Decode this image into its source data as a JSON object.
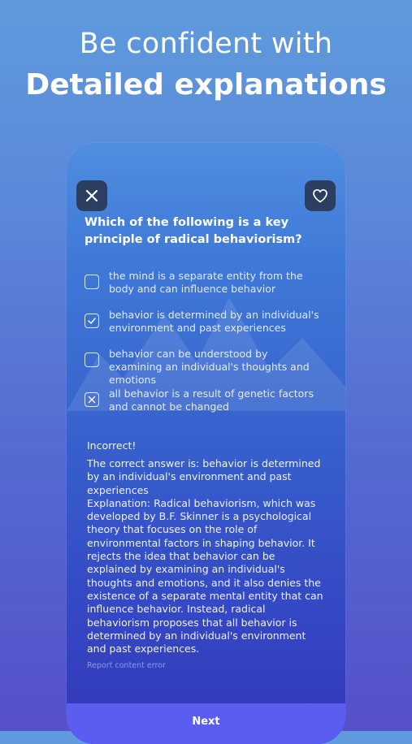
{
  "header": {
    "line1": "Be confident with",
    "line2": "Detailed explanations"
  },
  "toolbar": {
    "close_icon": "close-icon",
    "favorite_icon": "heart-icon"
  },
  "question": "Which of the following is a key principle of radical behaviorism?",
  "options": [
    {
      "label": "the mind is a separate entity from the body and can influence behavior",
      "state": "unchecked"
    },
    {
      "label": "behavior is determined by an individual's environment and past experiences",
      "state": "correct"
    },
    {
      "label": "behavior can be understood by examining an individual's thoughts and emotions",
      "state": "unchecked"
    },
    {
      "label": "all behavior is a result of genetic factors and cannot be changed",
      "state": "wrong"
    }
  ],
  "result": {
    "status": "Incorrect!",
    "correct_answer": "The correct answer is: behavior is determined by an individual's environment and past experiences",
    "explanation": "Explanation: Radical behaviorism, which was developed by B.F. Skinner is a psychological theory that focuses on the role of environmental factors in shaping behavior. It rejects the idea that behavior can be explained by examining an individual's thoughts and emotions, and it also denies the existence of a separate mental entity that can influence behavior. Instead, radical behaviorism proposes that all behavior is determined by an individual's environment and past experiences."
  },
  "report_link": "Report content error",
  "next_button": "Next",
  "colors": {
    "next_button": "#5b5cf0",
    "icon_button_bg": "#2c3f63"
  }
}
